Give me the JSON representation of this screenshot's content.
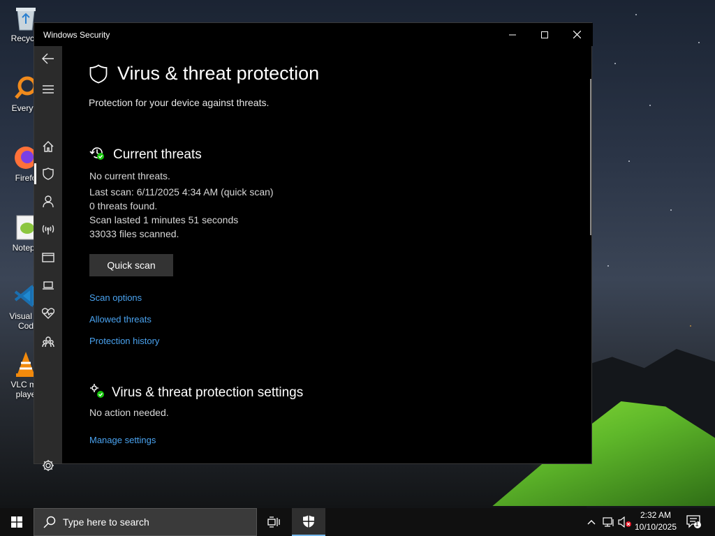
{
  "desktop": {
    "icons": [
      {
        "label": "Recycle",
        "icon": "recycle-bin-icon"
      },
      {
        "label": "Everyth",
        "icon": "everything-search-icon"
      },
      {
        "label": "Firefo",
        "icon": "firefox-icon"
      },
      {
        "label": "Notepa",
        "icon": "notepad-plus-plus-icon"
      },
      {
        "label": "Visual St",
        "label2": "Cod",
        "icon": "vscode-icon"
      },
      {
        "label": "VLC me",
        "label2": "playe",
        "icon": "vlc-icon"
      }
    ]
  },
  "window": {
    "title": "Windows Security",
    "controls": {
      "minimize": "minimize-icon",
      "maximize": "maximize-icon",
      "close": "close-icon"
    }
  },
  "nav": {
    "items": [
      {
        "name": "back",
        "icon": "back-arrow-icon"
      },
      {
        "name": "menu",
        "icon": "hamburger-menu-icon"
      },
      {
        "name": "home",
        "icon": "home-icon"
      },
      {
        "name": "virus-protection",
        "icon": "shield-icon",
        "selected": true
      },
      {
        "name": "account-protection",
        "icon": "person-icon"
      },
      {
        "name": "firewall",
        "icon": "wireless-signal-icon"
      },
      {
        "name": "app-browser-control",
        "icon": "browser-window-icon"
      },
      {
        "name": "device-security",
        "icon": "laptop-icon"
      },
      {
        "name": "device-performance",
        "icon": "heart-health-icon"
      },
      {
        "name": "family-options",
        "icon": "family-icon"
      },
      {
        "name": "settings",
        "icon": "gear-icon"
      }
    ]
  },
  "page": {
    "title": "Virus & threat protection",
    "subtitle": "Protection for your device against threats.",
    "current_threats": {
      "heading": "Current threats",
      "status": "No current threats.",
      "last_scan": "Last scan: 6/11/2025 4:34 AM (quick scan)",
      "threats_found": "0 threats found.",
      "duration": "Scan lasted 1 minutes 51 seconds",
      "files_scanned": "33033 files scanned.",
      "quick_scan_label": "Quick scan",
      "links": [
        "Scan options",
        "Allowed threats",
        "Protection history"
      ]
    },
    "settings": {
      "heading": "Virus & threat protection settings",
      "status": "No action needed.",
      "manage_link": "Manage settings"
    }
  },
  "taskbar": {
    "search_placeholder": "Type here to search",
    "time": "2:32 AM",
    "date": "10/10/2025",
    "notification_count": "1",
    "accent": "#76b9ed"
  },
  "colors": {
    "link": "#4aa3f0",
    "nav_bg": "#2b2b2b",
    "window_bg": "#000000",
    "status_green": "#16c60c"
  }
}
